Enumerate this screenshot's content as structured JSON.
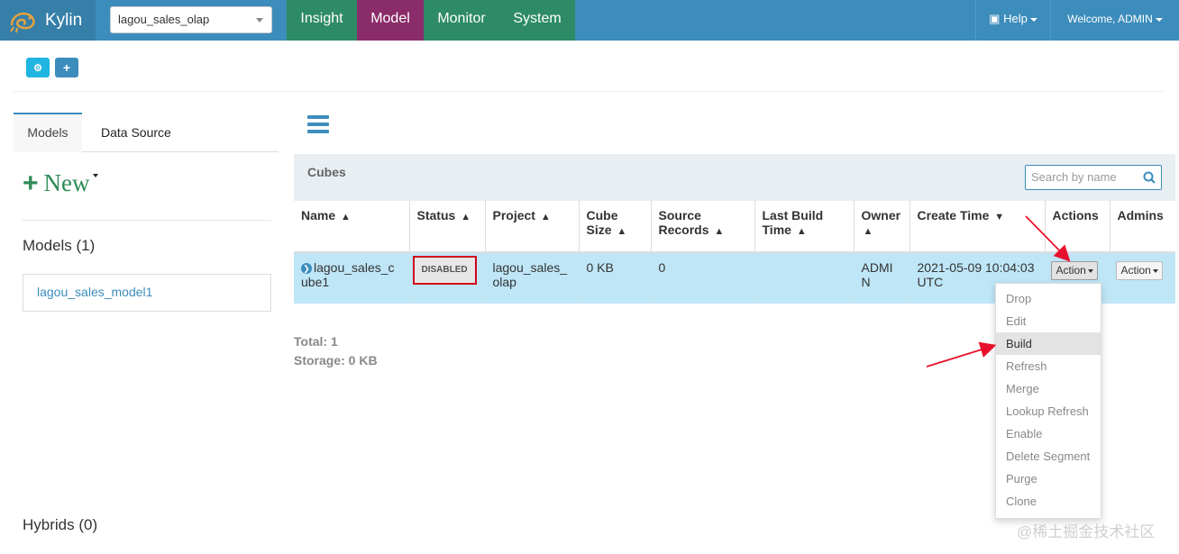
{
  "app": {
    "brand": "Kylin",
    "project": "lagou_sales_olap"
  },
  "nav": {
    "tabs": [
      "Insight",
      "Model",
      "Monitor",
      "System"
    ],
    "active": "Model",
    "help": "Help",
    "welcome": "Welcome, ADMIN"
  },
  "left": {
    "tabs": {
      "models": "Models",
      "data_source": "Data Source"
    },
    "new_label": "New",
    "models_heading": "Models (1)",
    "model_name": "lagou_sales_model1",
    "hybrids_heading": "Hybrids (0)"
  },
  "cubes": {
    "title": "Cubes",
    "search_placeholder": "Search by name",
    "headers": {
      "name": "Name",
      "status": "Status",
      "project": "Project",
      "cube_size_1": "Cube",
      "cube_size_2": "Size",
      "source_records_1": "Source",
      "source_records_2": "Records",
      "last_build_1": "Last Build",
      "last_build_2": "Time",
      "owner": "Owner",
      "create_time": "Create Time",
      "actions": "Actions",
      "admins": "Admins"
    },
    "row": {
      "name_1": "lagou_sales_c",
      "name_2": "ube1",
      "status": "DISABLED",
      "project_1": "lagou_sales_",
      "project_2": "olap",
      "cube_size": "0 KB",
      "source_records": "0",
      "last_build_time": "",
      "owner_1": "ADMI",
      "owner_2": "N",
      "create_time_1": "2021-05-09 10:04:03",
      "create_time_2": "UTC",
      "action_label": "Action",
      "admin_action_label": "Action"
    },
    "total": "Total: 1",
    "storage": "Storage: 0 KB"
  },
  "action_menu": {
    "items": [
      "Drop",
      "Edit",
      "Build",
      "Refresh",
      "Merge",
      "Lookup Refresh",
      "Enable",
      "Delete Segment",
      "Purge",
      "Clone"
    ],
    "highlighted": "Build"
  },
  "watermark": "@稀土掘金技术社区",
  "colors": {
    "nav_bg": "#3c8dbc",
    "nav_green": "#2e8b67",
    "nav_active": "#8b2c6a",
    "row_highlight": "#bfe6f7",
    "annotation_red": "#e8112d"
  }
}
